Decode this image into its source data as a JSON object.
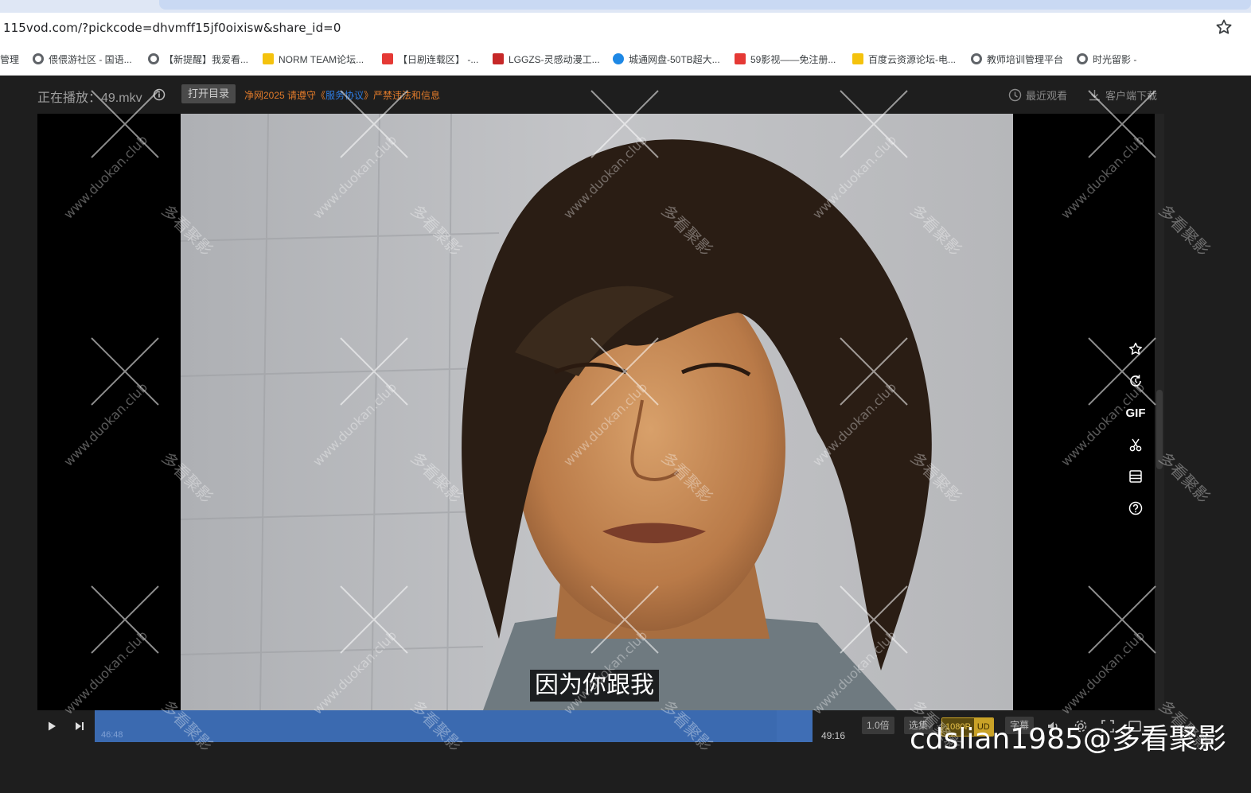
{
  "browser": {
    "url": "115vod.com/?pickcode=dhvmff15jf0oixisw&share_id=0",
    "bookmarks": [
      {
        "label": "管理",
        "icon": "none"
      },
      {
        "label": "偎偎游社区 - 国语...",
        "icon": "globe-icon"
      },
      {
        "label": "【新提醒】我爱看...",
        "icon": "globe-icon"
      },
      {
        "label": "NORM TEAM论坛...",
        "icon": "trophy-icon"
      },
      {
        "label": "【日剧连载区】 -...",
        "icon": "red-j-icon"
      },
      {
        "label": "LGGZS-灵感动漫工...",
        "icon": "dragon-icon"
      },
      {
        "label": "城通网盘-50TB超大...",
        "icon": "ct-icon"
      },
      {
        "label": "59影视——免注册...",
        "icon": "red-square-icon"
      },
      {
        "label": "百度云资源论坛-电...",
        "icon": "trophy-icon"
      },
      {
        "label": "教师培训管理平台",
        "icon": "globe-icon"
      },
      {
        "label": "时光留影 -",
        "icon": "globe-icon"
      }
    ]
  },
  "player": {
    "now_playing": "正在播放：49.mkv",
    "open_dir": "打开目录",
    "notice_part1": "净网2025 请遵守《",
    "notice_link": "服务协议",
    "notice_part2": "》严禁违法和信息",
    "recent": "最近观看",
    "client_download": "客户端下载",
    "subtitle": "因为你跟我",
    "side_tools": [
      "star-icon",
      "replay-icon",
      "GIF",
      "scissors-icon",
      "list-icon",
      "help-icon"
    ],
    "gif_label": "GIF",
    "current_time": "46:48",
    "total_time": "49:16",
    "progress": 0.95,
    "speed": "1.0倍",
    "episodes": "选集",
    "quality": "1080P",
    "quality_badge": "UD",
    "subtitles_btn": "字幕"
  },
  "watermark": {
    "text": "cdslian1985@多看聚影",
    "tile_text": "多看聚影",
    "tile_url": "www.duokan.club"
  },
  "colors": {
    "progress": "#3f6eb5",
    "notice": "#e07a2a",
    "link": "#2d7be0",
    "quality": "#c9a227"
  }
}
